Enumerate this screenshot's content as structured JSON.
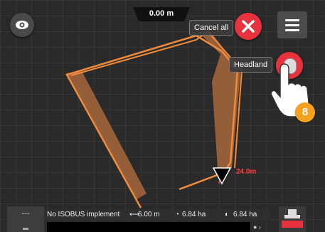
{
  "header": {
    "distance": "0.00 m"
  },
  "buttons": {
    "cancel_all_label": "Cancel all",
    "headland_label": "Headland"
  },
  "tutorial": {
    "step": "8"
  },
  "map": {
    "distance_to_line": "24.0m"
  },
  "status_bar": {
    "left_panel": "---",
    "implement": "No ISOBUS implement",
    "working_width": "6.00 m",
    "area_1": "6.84 ha",
    "area_2": "6.84 ha"
  },
  "colors": {
    "accent_red": "#e8333f",
    "boundary_orange": "#f08a3c",
    "badge_orange": "#f4a21d"
  }
}
